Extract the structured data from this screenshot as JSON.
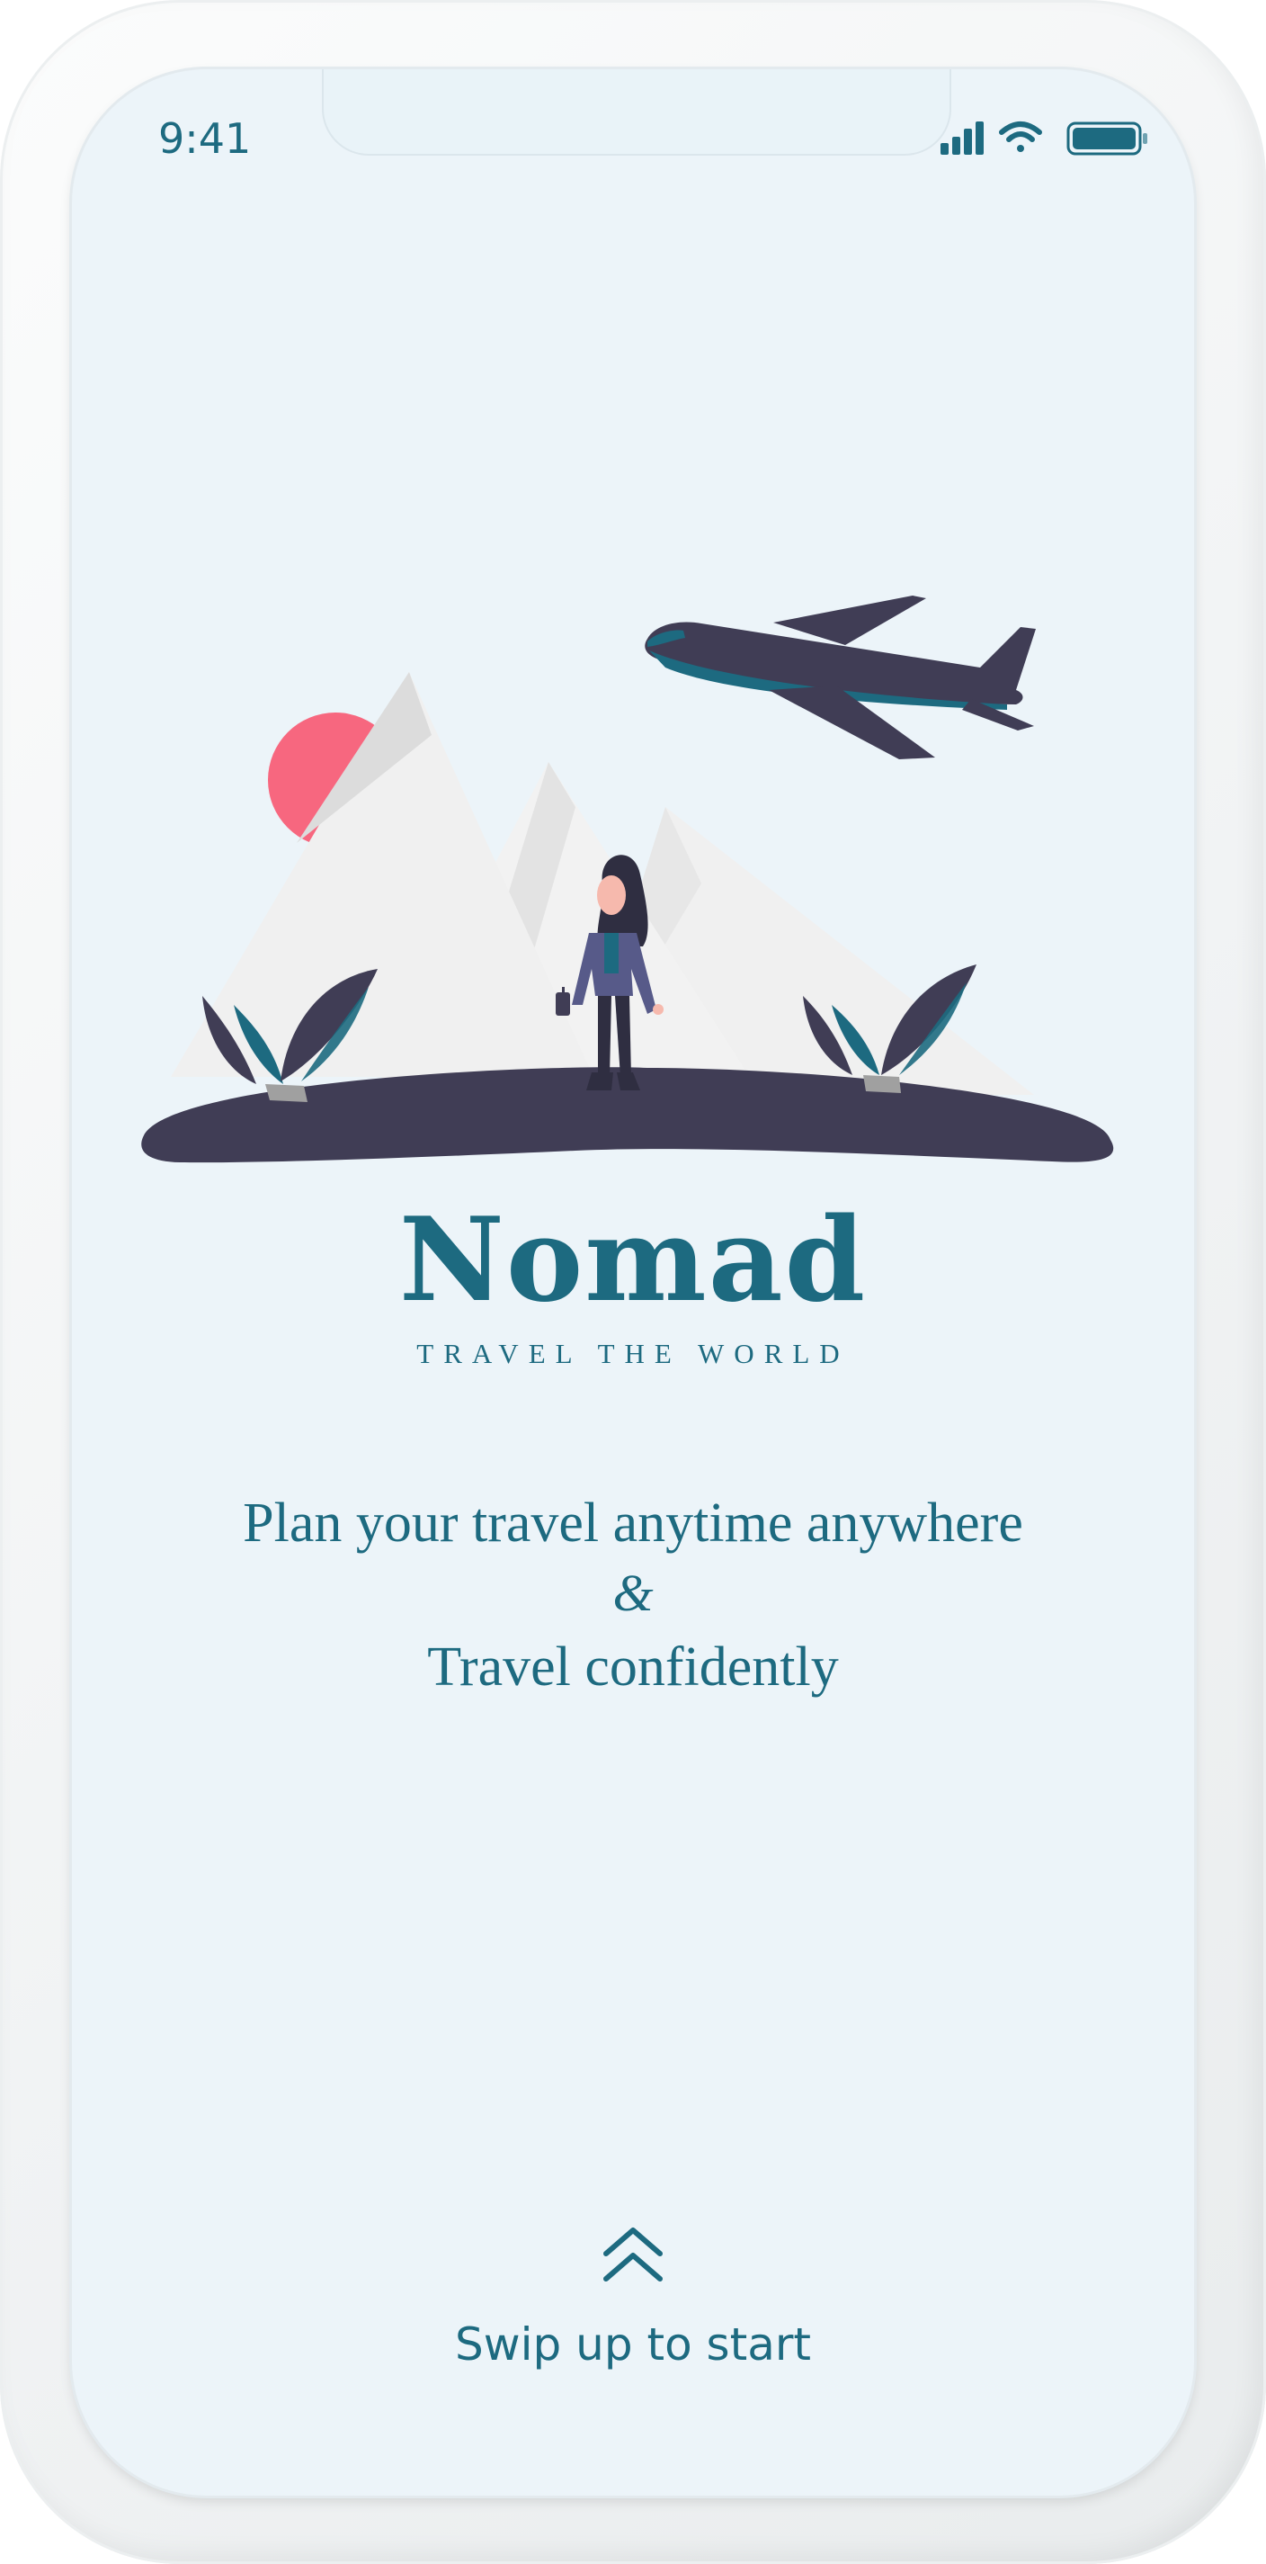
{
  "status_bar": {
    "time": "9:41",
    "icons": [
      "cellular-signal-icon",
      "wifi-icon",
      "battery-icon"
    ]
  },
  "brand": {
    "name": "Nomad",
    "tagline": "TRAVEL THE WORLD"
  },
  "message": {
    "line1": "Plan your travel anytime anywhere",
    "ampersand": "&",
    "line2": "Travel confidently"
  },
  "swipe": {
    "icon": "double-chevron-up-icon",
    "label": "Swip up to start"
  },
  "colors": {
    "accent": "#1d6a80",
    "background": "#ecf4f9",
    "ground": "#403d55",
    "sun": "#f7677f",
    "mountain": "#f0f0f0"
  }
}
